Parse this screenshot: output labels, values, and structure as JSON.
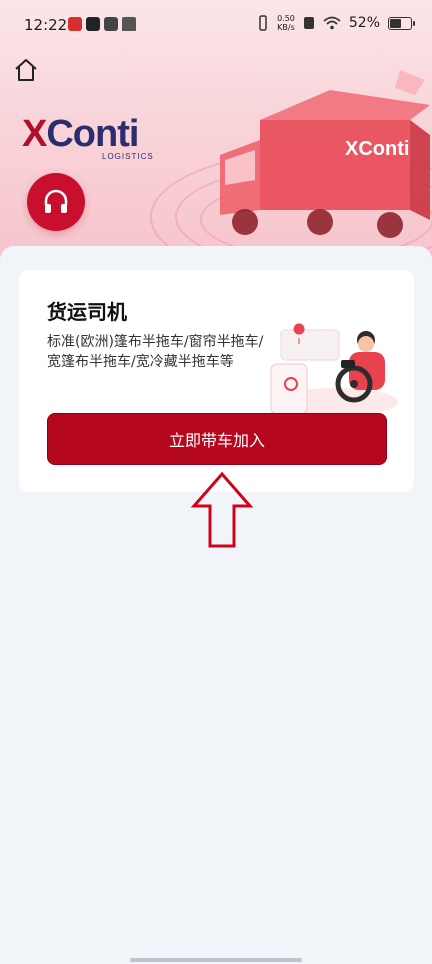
{
  "status_bar": {
    "time": "12:22",
    "net_speed_value": "0.50",
    "net_speed_unit": "KB/s",
    "battery": "52%"
  },
  "brand": {
    "logo_x": "X",
    "logo_rest": "Conti",
    "logo_sub": "LOGISTICS",
    "truck_logo": "XConti"
  },
  "card": {
    "title": "货运司机",
    "description_line1": "标准(欧洲)篷布半拖车/窗帘半拖车/",
    "description_line2": "宽篷布半拖车/宽冷藏半拖车等",
    "join_button": "立即带车加入"
  },
  "colors": {
    "brand_red": "#b5081f",
    "brand_navy": "#2b2d6e",
    "arrow_red": "#d0021b"
  },
  "icons": [
    "home-icon",
    "headphones-icon",
    "arrow-up-icon",
    "wifi-icon",
    "vibrate-icon",
    "battery-icon"
  ]
}
